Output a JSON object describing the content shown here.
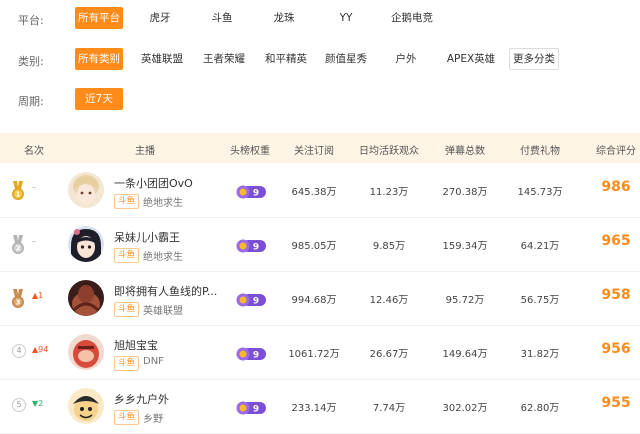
{
  "filters": {
    "platform": {
      "label": "平台:",
      "options": [
        "所有平台",
        "虎牙",
        "斗鱼",
        "龙珠",
        "YY",
        "企鹅电竞"
      ],
      "selected": "所有平台"
    },
    "category": {
      "label": "类别:",
      "options": [
        "所有类别",
        "英雄联盟",
        "王者荣耀",
        "和平精英",
        "颜值星秀",
        "户外",
        "APEX英雄",
        "更多分类"
      ],
      "selected": "所有类别"
    },
    "period": {
      "label": "周期:",
      "options": [
        "近7天"
      ],
      "selected": "近7天"
    }
  },
  "table": {
    "headers": [
      "名次",
      "主播",
      "头榜权重",
      "关注订阅",
      "日均活跃观众",
      "弹幕总数",
      "付费礼物",
      "综合评分"
    ],
    "rows": [
      {
        "rank": "1",
        "change": "–",
        "change_dir": "none",
        "name": "一条小团团OvO",
        "platform": "斗鱼",
        "category": "绝地求生",
        "weight": "9",
        "followers": "645.38万",
        "daily_active": "11.23万",
        "danmaku": "270.38万",
        "gifts": "145.73万",
        "score": "986"
      },
      {
        "rank": "2",
        "change": "–",
        "change_dir": "none",
        "name": "呆妹儿小霸王",
        "platform": "斗鱼",
        "category": "绝地求生",
        "weight": "9",
        "followers": "985.05万",
        "daily_active": "9.85万",
        "danmaku": "159.34万",
        "gifts": "64.21万",
        "score": "965"
      },
      {
        "rank": "3",
        "change": "1",
        "change_dir": "up",
        "name": "即将拥有人鱼线的P...",
        "platform": "斗鱼",
        "category": "英雄联盟",
        "weight": "9",
        "followers": "994.68万",
        "daily_active": "12.46万",
        "danmaku": "95.72万",
        "gifts": "56.75万",
        "score": "958"
      },
      {
        "rank": "4",
        "change": "94",
        "change_dir": "up",
        "name": "旭旭宝宝",
        "platform": "斗鱼",
        "category": "DNF",
        "weight": "9",
        "followers": "1061.72万",
        "daily_active": "26.67万",
        "danmaku": "149.64万",
        "gifts": "31.82万",
        "score": "956"
      },
      {
        "rank": "5",
        "change": "2",
        "change_dir": "down",
        "name": "乡乡九户外",
        "platform": "斗鱼",
        "category": "乡野",
        "weight": "9",
        "followers": "233.14万",
        "daily_active": "7.74万",
        "danmaku": "302.02万",
        "gifts": "62.80万",
        "score": "955"
      }
    ]
  },
  "colors": {
    "accent": "#ff8c1a",
    "header_bg": "#fdf4e6",
    "gold": "#e3a81e",
    "silver": "#b4b4b4",
    "bronze": "#c88a4d",
    "up": "#f5511e",
    "down": "#2db36b",
    "badge": "#7b4fd6"
  }
}
